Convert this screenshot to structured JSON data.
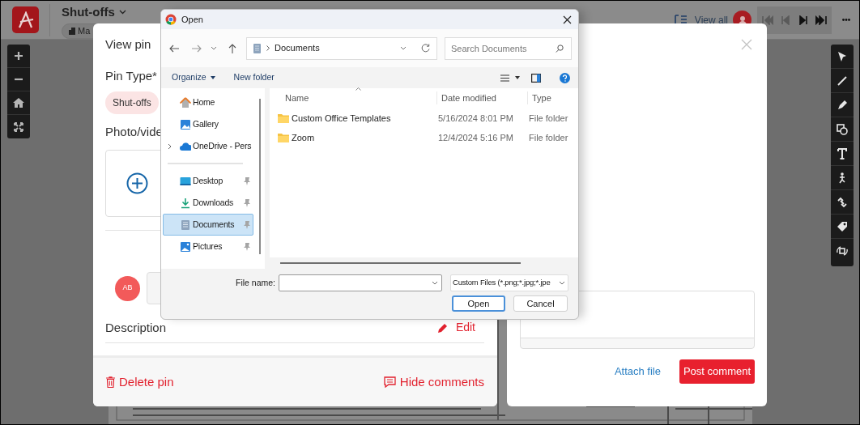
{
  "app": {
    "title": "Shut-offs",
    "chip": "Ma",
    "view_all": "View all"
  },
  "player_controls": [
    {
      "kind": "first",
      "disabled": true
    },
    {
      "kind": "previous",
      "disabled": true
    },
    {
      "kind": "next",
      "disabled": false
    },
    {
      "kind": "last",
      "disabled": false
    }
  ],
  "view_pin": {
    "title": "View pin",
    "pin_type_label": "Pin Type*",
    "pin_types": [
      {
        "label": "Shut-offs",
        "selected": true
      }
    ],
    "photo_label": "Photo/vide",
    "commenter_initials": "AB",
    "description_label": "Description",
    "edit": "Edit",
    "delete": "Delete pin",
    "hide_comments": "Hide comments"
  },
  "comments_panel": {
    "attach": "Attach file",
    "post": "Post comment"
  },
  "open_dialog": {
    "title": "Open",
    "path": "Documents",
    "search_placeholder": "Search Documents",
    "organize": "Organize",
    "new_folder": "New folder",
    "nav_groups": [
      [
        {
          "label": "Home",
          "kind": "home",
          "selected": false,
          "pinned": false,
          "expandable": false
        },
        {
          "label": "Gallery",
          "kind": "gallery",
          "selected": false,
          "pinned": false,
          "expandable": false
        },
        {
          "label": "OneDrive - Pers",
          "kind": "cloud",
          "selected": false,
          "pinned": false,
          "expandable": true
        }
      ],
      [
        {
          "label": "Desktop",
          "kind": "desktop",
          "selected": false,
          "pinned": true,
          "expandable": false
        },
        {
          "label": "Downloads",
          "kind": "download",
          "selected": false,
          "pinned": true,
          "expandable": false
        },
        {
          "label": "Documents",
          "kind": "documents",
          "selected": true,
          "pinned": true,
          "expandable": false
        },
        {
          "label": "Pictures",
          "kind": "pictures",
          "selected": false,
          "pinned": true,
          "expandable": false
        }
      ]
    ],
    "columns": [
      "Name",
      "Date modified",
      "Type"
    ],
    "files": [
      {
        "name": "Custom Office Templates",
        "date": "5/16/2024 8:01 PM",
        "type": "File folder"
      },
      {
        "name": "Zoom",
        "date": "12/4/2024 5:16 PM",
        "type": "File folder"
      }
    ],
    "file_name_label": "File name:",
    "filter": "Custom Files (*.png;*.jpg;*.jpe",
    "open": "Open",
    "cancel": "Cancel"
  }
}
